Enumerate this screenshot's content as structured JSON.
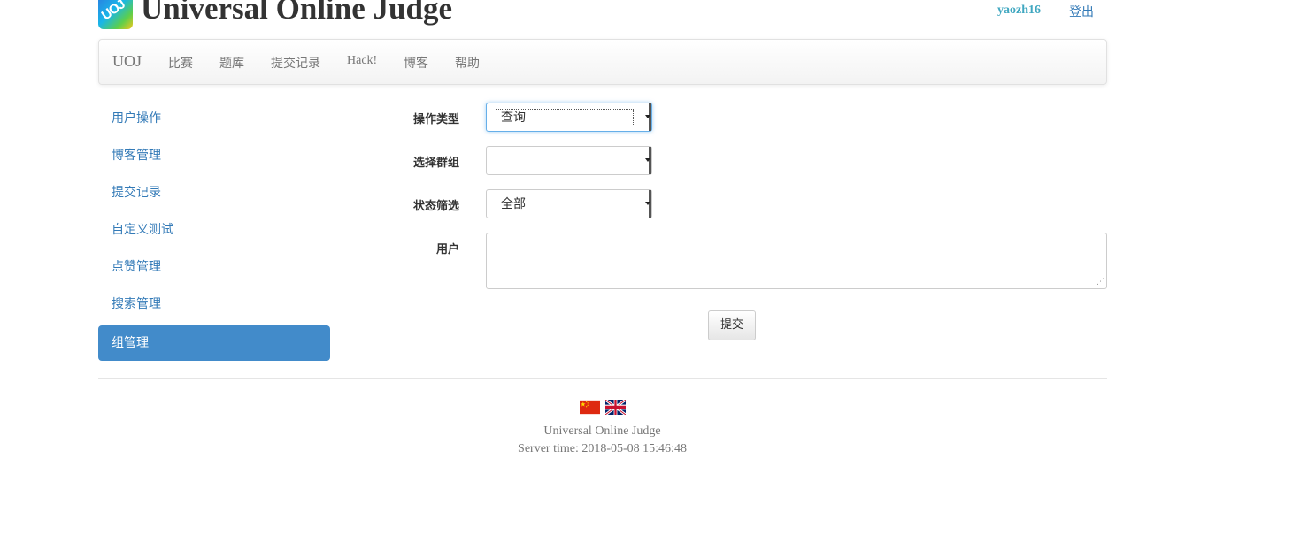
{
  "header": {
    "logo_text": "UOJ",
    "site_title": "Universal Online Judge",
    "username": "yaozh16",
    "logout_label": "登出"
  },
  "navbar": {
    "brand": "UOJ",
    "items": [
      {
        "label": "比赛"
      },
      {
        "label": "题库"
      },
      {
        "label": "提交记录"
      },
      {
        "label": "Hack!"
      },
      {
        "label": "博客"
      },
      {
        "label": "帮助"
      }
    ]
  },
  "sidebar": {
    "items": [
      {
        "label": "用户操作",
        "active": false
      },
      {
        "label": "博客管理",
        "active": false
      },
      {
        "label": "提交记录",
        "active": false
      },
      {
        "label": "自定义测试",
        "active": false
      },
      {
        "label": "点赞管理",
        "active": false
      },
      {
        "label": "搜索管理",
        "active": false
      },
      {
        "label": "组管理",
        "active": true
      }
    ]
  },
  "form": {
    "operation_type": {
      "label": "操作类型",
      "value": "查询"
    },
    "group": {
      "label": "选择群组",
      "value": ""
    },
    "status_filter": {
      "label": "状态筛选",
      "value": "全部"
    },
    "user": {
      "label": "用户",
      "value": ""
    },
    "submit_label": "提交"
  },
  "footer": {
    "site_name": "Universal Online Judge",
    "server_time": "Server time: 2018-05-08 15:46:48"
  },
  "colors": {
    "link": "#337ab7",
    "active_bg": "#428bca",
    "username": "#3fa7c0"
  }
}
